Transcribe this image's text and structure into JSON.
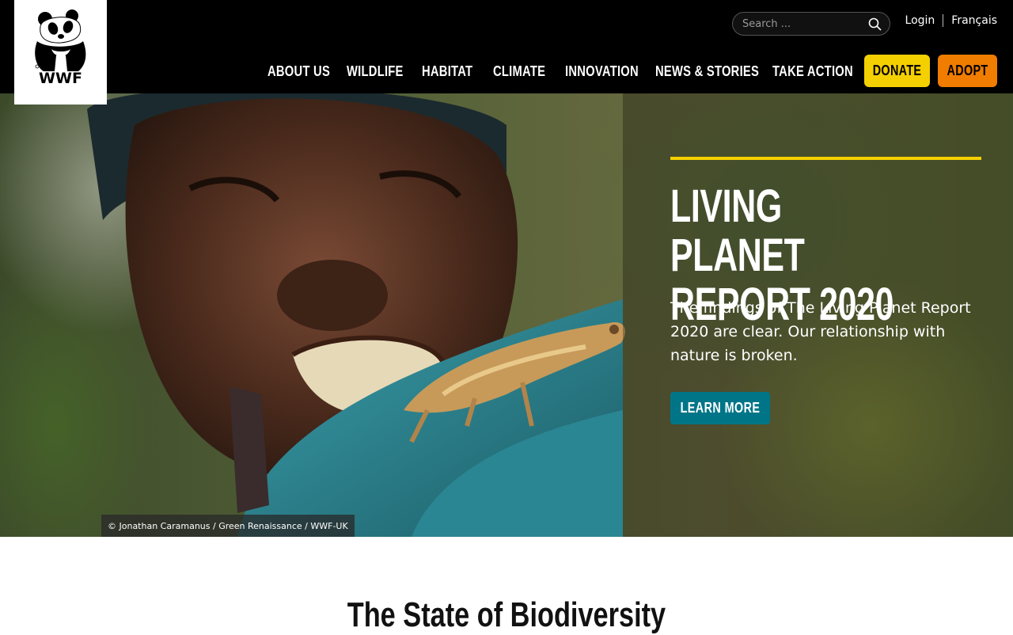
{
  "header": {
    "logo_text": "WWF",
    "search": {
      "placeholder": "Search ...",
      "value": ""
    },
    "login_label": "Login",
    "language_label": "Français",
    "nav": [
      {
        "label": "ABOUT US"
      },
      {
        "label": "WILDLIFE"
      },
      {
        "label": "HABITAT"
      },
      {
        "label": "CLIMATE"
      },
      {
        "label": "INNOVATION"
      },
      {
        "label": "NEWS & STORIES"
      },
      {
        "label": "TAKE ACTION"
      }
    ],
    "donate_label": "DONATE",
    "adopt_label": "ADOPT"
  },
  "hero": {
    "title": "LIVING PLANET\nREPORT 2020",
    "text": "The findings of The Living Planet Report 2020 are clear. Our relationship with nature is broken.",
    "cta_label": "LEARN MORE",
    "credit": "© Jonathan Caramanus / Green Renaissance / WWF-UK"
  },
  "section": {
    "title": "The State of Biodiversity"
  },
  "colors": {
    "header_bg": "#000000",
    "donate": "#f5d000",
    "adopt": "#f07c00",
    "accent_rule": "#f5d000",
    "cta": "#007588"
  },
  "icons": {
    "search": "search-icon",
    "logo": "panda-logo-icon"
  }
}
